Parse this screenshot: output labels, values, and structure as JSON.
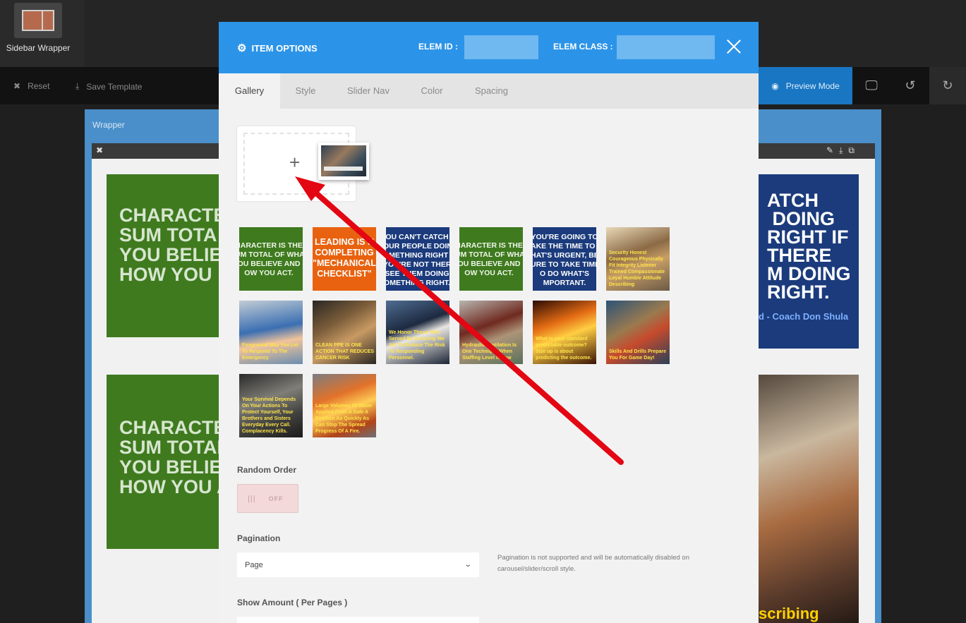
{
  "sidebar_wrapper": {
    "label": "Sidebar Wrapper"
  },
  "toolbar": {
    "reset_label": "Reset",
    "save_template_label": "Save Template",
    "preview_mode_label": "Preview Mode"
  },
  "wrapper": {
    "label": "Wrapper"
  },
  "background_cards": {
    "green_top_text": "CHARACTE\nSUM TOTA\nYOU BELIE\nHOW YOU",
    "green_bottom_text": "CHARACTE\nSUM TOTAL\nYOU BELIE\nHOW YOU A",
    "blue_text": "ATCH\n DOING\nRIGHT IF\nTHERE\nM DOING\nRIGHT.",
    "blue_sig": "d - Coach Don Shula",
    "photo_caption": "scribing"
  },
  "modal": {
    "title": "ITEM OPTIONS",
    "elem_id_label": "ELEM ID :",
    "elem_id_value": "",
    "elem_class_label": "ELEM CLASS :",
    "elem_class_value": "",
    "tabs": [
      {
        "label": "Gallery",
        "active": true
      },
      {
        "label": "Style",
        "active": false
      },
      {
        "label": "Slider Nav",
        "active": false
      },
      {
        "label": "Color",
        "active": false
      },
      {
        "label": "Spacing",
        "active": false
      }
    ],
    "gallery": {
      "add_glyph": "+",
      "tiles": [
        {
          "kind": "green",
          "text": "HARACTER IS THE\nUM TOTAL OF WHAT\nOU BELIEVE AND\nOW YOU ACT."
        },
        {
          "kind": "orange",
          "text": "LEADING IS N\nCOMPLETING\n\"MECHANICAL\nCHECKLIST\""
        },
        {
          "kind": "blue",
          "text": "OU CAN'T CATCH\nOUR PEOPLE DOING\nOMETHING RIGHT IF\nYOU'RE NOT THERE\nSEE THEM DOING\nOMETHING RIGHT."
        },
        {
          "kind": "green",
          "text": "HARACTER IS THE\nUM TOTAL OF WHAT\nOU BELIEVE AND\nOW YOU ACT."
        },
        {
          "kind": "blue",
          "text": "YOU'RE GOING TO\nAKE THE TIME TO DO\nHAT'S URGENT, BE\nURE TO TAKE TIME\nO DO WHAT'S\nMPORTANT."
        },
        {
          "kind": "photo",
          "variant": "p1",
          "text": "Security Honest Courageous Physically Fit Integrity Listener Trained Compassionate Loyal Humble Attitude Describing"
        },
        {
          "kind": "photo",
          "variant": "p2",
          "text": "Fireground May You Let To Respond To The Emergency"
        },
        {
          "kind": "photo",
          "variant": "p3",
          "text": "CLEAN PPE IS ONE ACTION THAT REDUCES CANCER RISK"
        },
        {
          "kind": "photo",
          "variant": "p4",
          "text": "We Honor Those Who Served By Ensuring We Act To Reduce The Risk To Responding Personnel."
        },
        {
          "kind": "photo",
          "variant": "p5",
          "text": "Hydraulic Ventilation Is One Technique When Staffing Level Is Low"
        },
        {
          "kind": "photo",
          "variant": "p6",
          "text": "What is your standard predictable outcome? Size up is about predicting the outcome."
        },
        {
          "kind": "photo",
          "variant": "p7",
          "text": "Skills And Drills Prepare You For Game Day!"
        },
        {
          "kind": "photo",
          "variant": "p8",
          "text": "Your Survival Depends On Your Actions To Protect Yourself, Your Brothers and Sisters Everyday Every Call. Complacency Kills."
        },
        {
          "kind": "photo",
          "variant": "p9",
          "text": "Large Volumes Of Water Applied From A Safe A Position As Quickly As Can Stop The Spread Progress Of A Fire."
        }
      ]
    },
    "random_order": {
      "label": "Random Order",
      "state": "OFF"
    },
    "pagination": {
      "label": "Pagination",
      "selected": "Page",
      "note": "Pagination is not supported and will be automatically disabled on carousel/slider/scroll style."
    },
    "show_amount": {
      "label": "Show Amount ( Per Pages )"
    }
  },
  "colors": {
    "modal_header": "#2c94e8",
    "preview_button": "#1976c2",
    "annotation_arrow": "#e30613"
  }
}
